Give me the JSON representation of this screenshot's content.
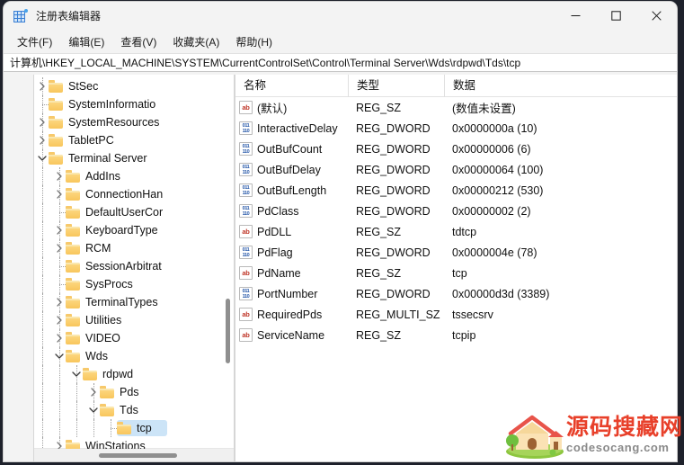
{
  "window": {
    "title": "注册表编辑器",
    "app_icon": "registry-editor-icon",
    "controls": {
      "minimize": "minimize-icon",
      "maximize": "maximize-icon",
      "close": "close-icon"
    }
  },
  "menubar": {
    "items": [
      {
        "label": "文件(F)"
      },
      {
        "label": "编辑(E)"
      },
      {
        "label": "查看(V)"
      },
      {
        "label": "收藏夹(A)"
      },
      {
        "label": "帮助(H)"
      }
    ]
  },
  "address": {
    "path": "计算机\\HKEY_LOCAL_MACHINE\\SYSTEM\\CurrentControlSet\\Control\\Terminal Server\\Wds\\rdpwd\\Tds\\tcp"
  },
  "tree": {
    "items": [
      {
        "label": "StSec",
        "depth": 1,
        "state": "collapsed",
        "selected": false
      },
      {
        "label": "SystemInformatio",
        "depth": 1,
        "state": "leaf",
        "selected": false
      },
      {
        "label": "SystemResources",
        "depth": 1,
        "state": "collapsed",
        "selected": false
      },
      {
        "label": "TabletPC",
        "depth": 1,
        "state": "collapsed",
        "selected": false
      },
      {
        "label": "Terminal Server",
        "depth": 1,
        "state": "expanded",
        "selected": false
      },
      {
        "label": "AddIns",
        "depth": 2,
        "state": "collapsed",
        "selected": false
      },
      {
        "label": "ConnectionHan",
        "depth": 2,
        "state": "collapsed",
        "selected": false
      },
      {
        "label": "DefaultUserCor",
        "depth": 2,
        "state": "leaf",
        "selected": false
      },
      {
        "label": "KeyboardType",
        "depth": 2,
        "state": "collapsed",
        "selected": false
      },
      {
        "label": "RCM",
        "depth": 2,
        "state": "collapsed",
        "selected": false
      },
      {
        "label": "SessionArbitrat",
        "depth": 2,
        "state": "leaf",
        "selected": false
      },
      {
        "label": "SysProcs",
        "depth": 2,
        "state": "leaf",
        "selected": false
      },
      {
        "label": "TerminalTypes",
        "depth": 2,
        "state": "collapsed",
        "selected": false
      },
      {
        "label": "Utilities",
        "depth": 2,
        "state": "collapsed",
        "selected": false
      },
      {
        "label": "VIDEO",
        "depth": 2,
        "state": "collapsed",
        "selected": false
      },
      {
        "label": "Wds",
        "depth": 2,
        "state": "expanded",
        "selected": false
      },
      {
        "label": "rdpwd",
        "depth": 3,
        "state": "expanded",
        "selected": false
      },
      {
        "label": "Pds",
        "depth": 4,
        "state": "collapsed",
        "selected": false
      },
      {
        "label": "Tds",
        "depth": 4,
        "state": "expanded",
        "selected": false
      },
      {
        "label": "tcp",
        "depth": 5,
        "state": "leaf",
        "selected": true
      },
      {
        "label": "WinStations",
        "depth": 2,
        "state": "collapsed",
        "selected": false
      }
    ],
    "selection_color": "#cce4f7"
  },
  "list": {
    "columns": [
      {
        "label": "名称"
      },
      {
        "label": "类型"
      },
      {
        "label": "数据"
      }
    ],
    "rows": [
      {
        "icon": "string-value-icon",
        "name": "(默认)",
        "type": "REG_SZ",
        "data": "(数值未设置)"
      },
      {
        "icon": "dword-value-icon",
        "name": "InteractiveDelay",
        "type": "REG_DWORD",
        "data": "0x0000000a (10)"
      },
      {
        "icon": "dword-value-icon",
        "name": "OutBufCount",
        "type": "REG_DWORD",
        "data": "0x00000006 (6)"
      },
      {
        "icon": "dword-value-icon",
        "name": "OutBufDelay",
        "type": "REG_DWORD",
        "data": "0x00000064 (100)"
      },
      {
        "icon": "dword-value-icon",
        "name": "OutBufLength",
        "type": "REG_DWORD",
        "data": "0x00000212 (530)"
      },
      {
        "icon": "dword-value-icon",
        "name": "PdClass",
        "type": "REG_DWORD",
        "data": "0x00000002 (2)"
      },
      {
        "icon": "string-value-icon",
        "name": "PdDLL",
        "type": "REG_SZ",
        "data": "tdtcp"
      },
      {
        "icon": "dword-value-icon",
        "name": "PdFlag",
        "type": "REG_DWORD",
        "data": "0x0000004e (78)"
      },
      {
        "icon": "string-value-icon",
        "name": "PdName",
        "type": "REG_SZ",
        "data": "tcp"
      },
      {
        "icon": "dword-value-icon",
        "name": "PortNumber",
        "type": "REG_DWORD",
        "data": "0x00000d3d (3389)"
      },
      {
        "icon": "string-value-icon",
        "name": "RequiredPds",
        "type": "REG_MULTI_SZ",
        "data": "tssecsrv"
      },
      {
        "icon": "string-value-icon",
        "name": "ServiceName",
        "type": "REG_SZ",
        "data": "tcpip"
      }
    ]
  },
  "watermark": {
    "title": "源码搜藏网",
    "subtitle": "codesocang.com",
    "title_color": "#e8402a"
  }
}
